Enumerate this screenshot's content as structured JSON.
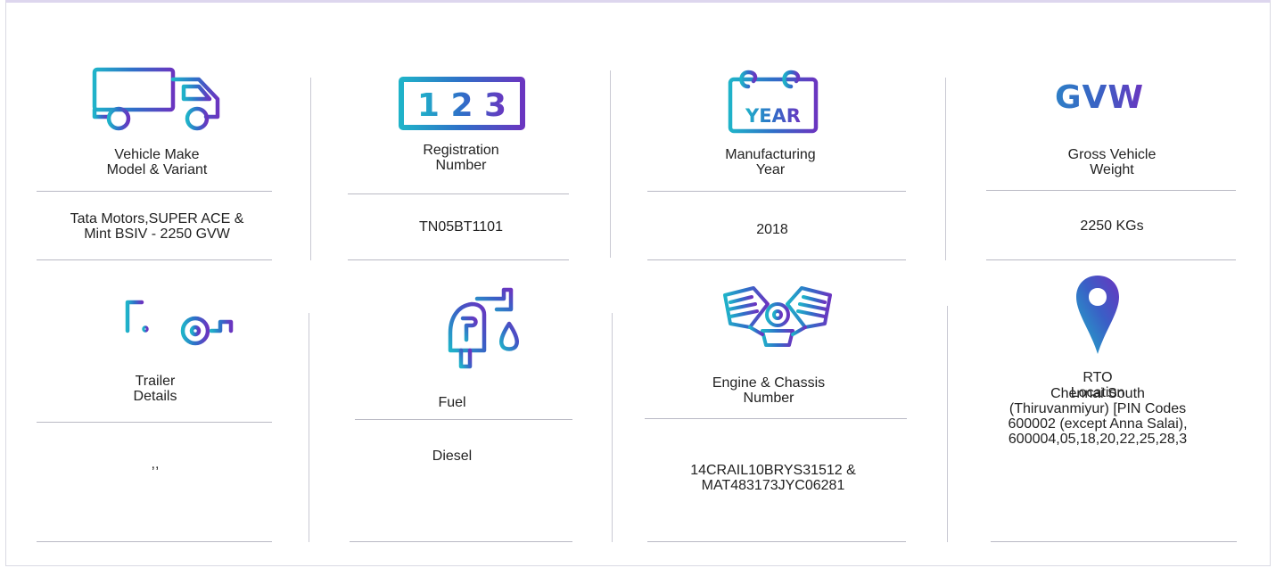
{
  "colors": {
    "gradient_start": "#1fa9c9",
    "gradient_mid": "#2f6fc8",
    "gradient_end": "#6a35c0",
    "divider": "#b9b9c4",
    "text": "#222222"
  },
  "cards": [
    {
      "icon": "truck-icon",
      "label": "Vehicle Make\nModel & Variant",
      "value": "Tata Motors,SUPER ACE &\nMint BSIV - 2250 GVW"
    },
    {
      "icon": "registration-number-icon",
      "icon_text": "1 2 3",
      "label": "Registration\nNumber",
      "value": "TN05BT1101"
    },
    {
      "icon": "calendar-year-icon",
      "icon_text": "YEAR",
      "label": "Manufacturing\nYear",
      "value": "2018"
    },
    {
      "icon": "gvw-icon",
      "icon_text": "GVW",
      "label": "Gross Vehicle\nWeight",
      "value": "2250 KGs"
    },
    {
      "icon": "trailer-icon",
      "label": "Trailer\nDetails",
      "value": ",,"
    },
    {
      "icon": "fuel-pump-icon",
      "label": "Fuel",
      "value": "Diesel"
    },
    {
      "icon": "engine-icon",
      "label": "Engine & Chassis\nNumber",
      "value": "14CRAIL10BRYS31512 &\nMAT483173JYC06281"
    },
    {
      "icon": "location-pin-icon",
      "label": "RTO\nLocation",
      "value": "Chennai South\n(Thiruvanmiyur) [PIN Codes\n600002 (except Anna Salai),\n600004,05,18,20,22,25,28,3"
    }
  ]
}
